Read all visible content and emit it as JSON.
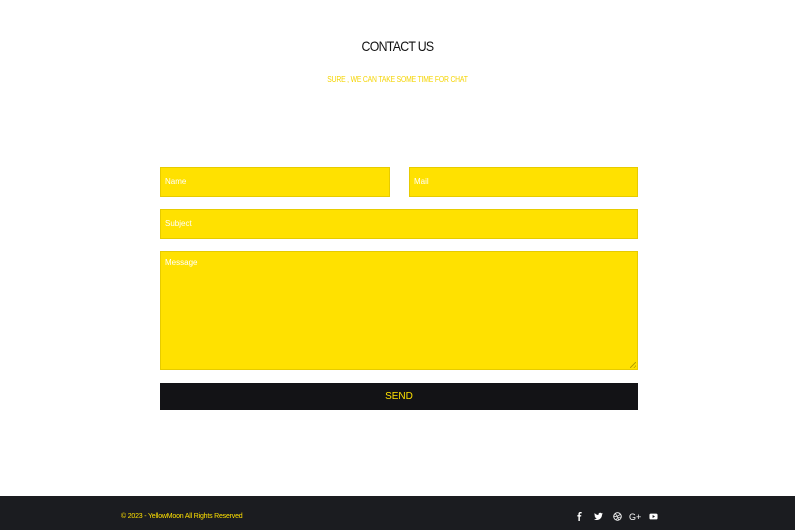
{
  "header": {
    "title": "CONTACT US",
    "subtitle": "SURE , WE CAN TAKE SOME TIME FOR CHAT"
  },
  "form": {
    "name_placeholder": "Name",
    "mail_placeholder": "Mail",
    "subject_placeholder": "Subject",
    "message_placeholder": "Message",
    "send_label": "SEND"
  },
  "footer": {
    "copyright": "© 2023 - YellowMoon All Rights Reserved",
    "social_icons": [
      "facebook-icon",
      "twitter-icon",
      "dribbble-icon",
      "google-plus-icon",
      "youtube-icon"
    ],
    "gplus_text": "G+"
  },
  "colors": {
    "accent": "#ffe100",
    "dark": "#131316",
    "footer_bg": "#1b1c20"
  }
}
